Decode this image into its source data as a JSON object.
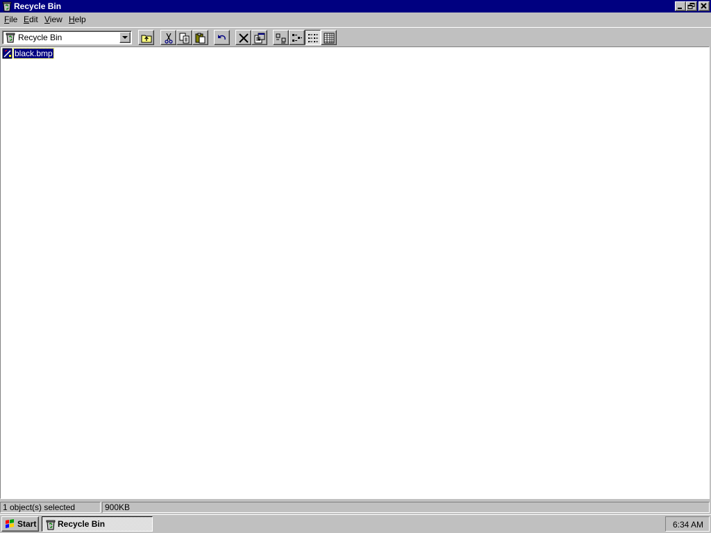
{
  "window": {
    "title": "Recycle Bin",
    "icon": "recycle-bin-icon",
    "controls": [
      "minimize",
      "restore",
      "close"
    ]
  },
  "menu": {
    "items": [
      {
        "label": "File",
        "accel": "F",
        "rest": "ile"
      },
      {
        "label": "Edit",
        "accel": "E",
        "rest": "dit"
      },
      {
        "label": "View",
        "accel": "V",
        "rest": "iew"
      },
      {
        "label": "Help",
        "accel": "H",
        "rest": "elp"
      }
    ]
  },
  "toolbar": {
    "address": "Recycle Bin",
    "buttons": [
      "up-one-level",
      "cut",
      "copy",
      "paste",
      "undo",
      "delete",
      "properties",
      "large-icons",
      "small-icons",
      "list",
      "details"
    ],
    "active_view": "list"
  },
  "files": [
    {
      "name": "black.bmp",
      "icon": "bitmap-file-icon",
      "selected": true
    }
  ],
  "status": {
    "selection": "1 object(s) selected",
    "size": "900KB"
  },
  "taskbar": {
    "start_label": "Start",
    "task_label": "Recycle Bin",
    "clock": "6:34 AM"
  },
  "colors": {
    "titlebar": "#000080",
    "face": "#c0c0c0",
    "selection": "#000080"
  }
}
